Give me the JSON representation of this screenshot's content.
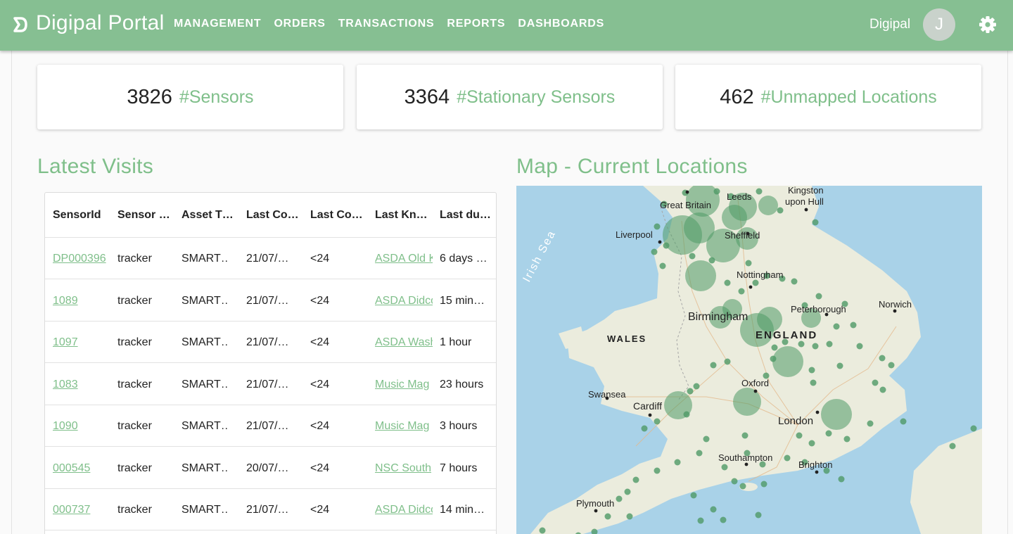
{
  "header": {
    "brand": "Digipal Portal",
    "nav": [
      "MANAGEMENT",
      "ORDERS",
      "TRANSACTIONS",
      "REPORTS",
      "DASHBOARDS"
    ],
    "user_name": "Digipal",
    "avatar_initial": "J",
    "colors": {
      "bar": "#86bf92",
      "accent": "#7fbf8a"
    }
  },
  "stats": [
    {
      "value": "3826",
      "label": "#Sensors"
    },
    {
      "value": "3364",
      "label": "#Stationary Sensors"
    },
    {
      "value": "462",
      "label": "#Unmapped Locations"
    }
  ],
  "latest_visits": {
    "title": "Latest Visits",
    "columns": [
      "SensorId",
      "Sensor …",
      "Asset T…",
      "Last Co…",
      "Last Co…",
      "Last Kn…",
      "Last du…"
    ],
    "rows": [
      [
        "DP000396",
        "tracker",
        "SMART…",
        "21/07/…",
        "<24",
        "ASDA Old K",
        "6 days …"
      ],
      [
        "1089",
        "tracker",
        "SMART…",
        "21/07/…",
        "<24",
        "ASDA Didco",
        "15 min…"
      ],
      [
        "1097",
        "tracker",
        "SMART…",
        "21/07/…",
        "<24",
        "ASDA Wash",
        "1 hour"
      ],
      [
        "1083",
        "tracker",
        "SMART…",
        "21/07/…",
        "<24",
        "Music Mag",
        "23 hours"
      ],
      [
        "1090",
        "tracker",
        "SMART…",
        "21/07/…",
        "<24",
        "Music Mag",
        "3 hours"
      ],
      [
        "000545",
        "tracker",
        "SMART…",
        "20/07/…",
        "<24",
        "NSC South",
        "7 hours"
      ],
      [
        "000737",
        "tracker",
        "SMART…",
        "21/07/…",
        "<24",
        "ASDA Didco",
        "14 min…"
      ]
    ]
  },
  "map": {
    "title": "Map - Current Locations",
    "labels": {
      "irish_sea": "Irish Sea",
      "kingston": "Kingston",
      "kingston2": "upon Hull",
      "leeds": "Leeds",
      "great_britain": "Great Britain",
      "liverpool": "Liverpool",
      "sheffield": "Sheffield",
      "nottingham": "Nottingham",
      "peterborough": "Peterborough",
      "norwich": "Norwich",
      "birmingham": "Birmingham",
      "england": "ENGLAND",
      "wales": "WALES",
      "oxford": "Oxford",
      "swansea": "Swansea",
      "cardiff": "Cardiff",
      "london": "London",
      "southampton": "Southampton",
      "brighton": "Brighton",
      "plymouth": "Plymouth"
    },
    "colors": {
      "sea": "#a9d2e8",
      "land": "#ebecdd",
      "marker": "#4f9a66"
    }
  }
}
